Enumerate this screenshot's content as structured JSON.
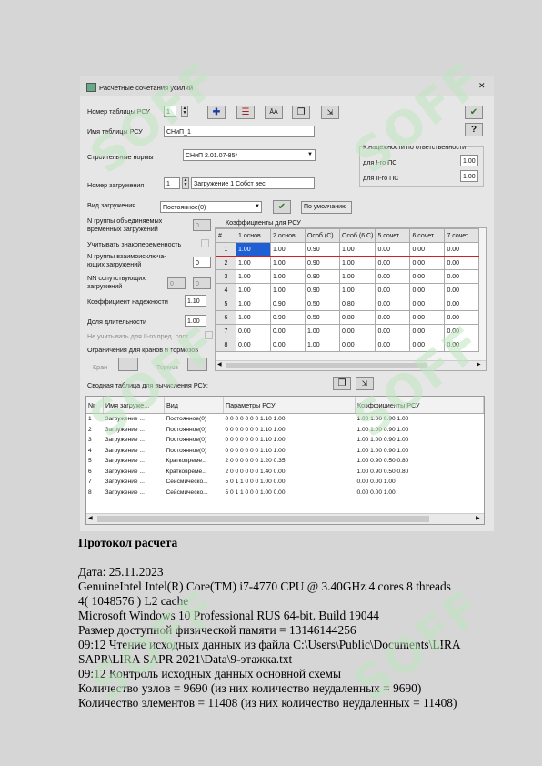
{
  "dialog": {
    "title": "Расчетные сочетания усилий",
    "close": "✕",
    "rsu_table_no_label": "Номер таблицы РСУ",
    "rsu_table_no": "1",
    "rsu_table_name_label": "Имя таблицы РСУ",
    "rsu_table_name": "СНиП_1",
    "norms_label": "Строительные нормы",
    "norms_value": "СНиП 2.01.07-85*",
    "reliability_title": "К.надежности по ответственности",
    "reliability_1_label": "для I-го ПС",
    "reliability_1": "1.00",
    "reliability_2_label": "для II-го ПС",
    "reliability_2": "1.00",
    "load_no_label": "Номер загружения",
    "load_no": "1",
    "load_name": "Загружение 1 Собст вес",
    "load_type_label": "Вид загружения",
    "load_type": "Постоянное(0)",
    "default_button": "По умолчанию",
    "group_combined_label": "N группы объединяемых временных загружений",
    "group_combined": "0",
    "sign_change_label": "Учитывать знакопеременность",
    "group_exclusive_label": "N группы взаимоисключа- ющих загружений",
    "group_exclusive": "0",
    "accompanying_label": "NN сопутствующих загружений",
    "accompanying_1": "0",
    "accompanying_2": "0",
    "reliability_coef_label": "Коэффициент надежности",
    "reliability_coef": "1.10",
    "duration_label": "Доля длительности",
    "duration": "1.00",
    "ignore_label": "Не учитывать для II-го пред. сост.",
    "cranes_label": "Ограничения для кранов и тормозов",
    "crane_label": "Кран",
    "brake_label": "Тормоз",
    "coef_title": "Коэффициенты для РСУ",
    "summary_title": "Сводная таблица для вычисления РСУ:"
  },
  "coef_table": {
    "headers": [
      "#",
      "1 основ.",
      "2 основ.",
      "Особ.(С)",
      "Особ.(6 С)",
      "5 сочет.",
      "6 сочет.",
      "7 сочет."
    ],
    "rows": [
      [
        "1",
        "1.00",
        "1.00",
        "0.90",
        "1.00",
        "0.00",
        "0.00",
        "0.00"
      ],
      [
        "2",
        "1.00",
        "1.00",
        "0.90",
        "1.00",
        "0.00",
        "0.00",
        "0.00"
      ],
      [
        "3",
        "1.00",
        "1.00",
        "0.90",
        "1.00",
        "0.00",
        "0.00",
        "0.00"
      ],
      [
        "4",
        "1.00",
        "1.00",
        "0.90",
        "1.00",
        "0.00",
        "0.00",
        "0.00"
      ],
      [
        "5",
        "1.00",
        "0.90",
        "0.50",
        "0.80",
        "0.00",
        "0.00",
        "0.00"
      ],
      [
        "6",
        "1.00",
        "0.90",
        "0.50",
        "0.80",
        "0.00",
        "0.00",
        "0.00"
      ],
      [
        "7",
        "0.00",
        "0.00",
        "1.00",
        "0.00",
        "0.00",
        "0.00",
        "0.00"
      ],
      [
        "8",
        "0.00",
        "0.00",
        "1.00",
        "0.00",
        "0.00",
        "0.00",
        "0.00"
      ]
    ]
  },
  "summary_table": {
    "headers": [
      "№",
      "Имя загруже...",
      "Вид",
      "Параметры РСУ",
      "Коэффициенты РСУ"
    ],
    "rows": [
      [
        "1",
        "Загружение ...",
        "Постоянное(0)",
        "0 0 0 0 0 0 0 1.10 1.00",
        "1.00 1.00 0.90 1.00"
      ],
      [
        "2",
        "Загружение ...",
        "Постоянное(0)",
        "0 0 0 0 0 0 0 1.10 1.00",
        "1.00 1.00 0.90 1.00"
      ],
      [
        "3",
        "Загружение ...",
        "Постоянное(0)",
        "0 0 0 0 0 0 0 1.10 1.00",
        "1.00 1.00 0.90 1.00"
      ],
      [
        "4",
        "Загружение ...",
        "Постоянное(0)",
        "0 0 0 0 0 0 0 1.10 1.00",
        "1.00 1.00 0.90 1.00"
      ],
      [
        "5",
        "Загружение ...",
        "Кратковреме...",
        "2 0 0 0 0 0 0 1.20 0.35",
        "1.00 0.90 0.50 0.80"
      ],
      [
        "6",
        "Загружение ...",
        "Кратковреме...",
        "2 0 0 0 0 0 0 1.40 0.00",
        "1.00 0.90 0.50 0.80"
      ],
      [
        "7",
        "Загружение ...",
        "Сейсмическо...",
        "5 0 1 1 0 0 0 1.00 0.00",
        "0.00 0.00 1.00"
      ],
      [
        "8",
        "Загружение ...",
        "Сейсмическо...",
        "5 0 1 1 0 0 0 1.00 0.00",
        "0.00 0.00 1.00"
      ]
    ]
  },
  "document": {
    "heading": "Протокол расчета",
    "lines": [
      "Дата: 25.11.2023",
      "GenuineIntel    Intel(R) Core(TM) i7-4770 CPU @ 3.40GHz    4 cores    8 threads",
      "4( 1048576 ) L2 cache",
      "Microsoft Windows 10 Professional RUS 64-bit. Build 19044",
      "Размер доступной физической памяти = 13146144256",
      "09:12  Чтение исходных данных из файла C:\\Users\\Public\\Documents\\LIRA",
      "SAPR\\LIRA SAPR 2021\\Data\\9-этажка.txt",
      "09:12  Контроль исходных данных основной схемы",
      "Количество узлов = 9690 (из них количество неудаленных = 9690)",
      "Количество элементов = 11408 (из них количество неудаленных = 11408)"
    ]
  },
  "watermark": "SOFF"
}
